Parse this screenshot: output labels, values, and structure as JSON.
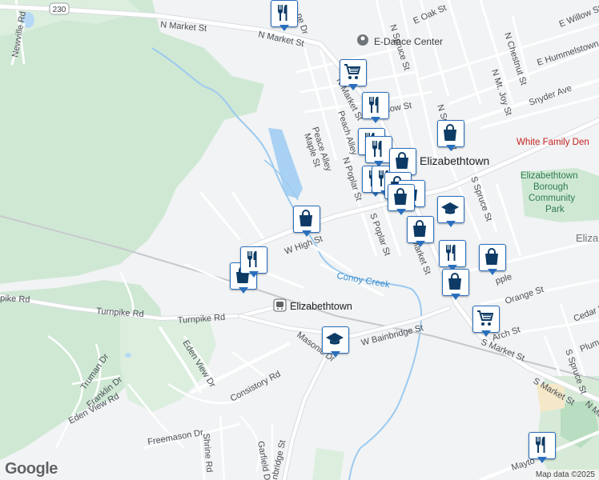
{
  "map": {
    "streets": {
      "n_market_1": "N Market St",
      "n_market_2": "N Market St",
      "n_market_3": "N Market St",
      "n_market_4": "N Market St",
      "route": "230",
      "newville": "Newville Rd",
      "w_high": "W High St",
      "turnpike_1": "Turnpike Rd",
      "turnpike_2": "Turnpike Rd",
      "pike": "pike Rd",
      "w_bainbridge": "W Bainbridge St",
      "s_market_1": "S Market St",
      "s_market_2": "S Market St",
      "masonic": "Masonic Dr",
      "consistory": "Consistory Rd",
      "eden_view_dr": "Eden View Dr",
      "eden_view_rd": "Eden View Rd",
      "truman": "Truman Dr",
      "franklin": "Franklin Dr",
      "freemason": "Freemason Dr",
      "shrine": "Shrine Rd",
      "garfield": "Garfield Dr",
      "bainbridge_n": "nbridge St",
      "peach_alley": "Peach Alley",
      "peace_alley": "Peace Alley",
      "maple": "Maple St",
      "n_poplar": "N Poplar St",
      "s_poplar": "S Poplar St",
      "n_spruce": "N Spruce St",
      "s_spruce_1": "S Spruce St",
      "s_spruce_2": "S Spruce St",
      "n_chestnut": "N Chestnut St",
      "n_mt_joy": "N Mt. Joy St",
      "snyder": "Snyder Ave",
      "e_hummelstown": "E Hummelstown St",
      "e_willow": "E Willow St",
      "e_oak": "E Oak St",
      "n_spruce_top": "N Spruce St",
      "orange": "Orange St",
      "arch": "Arch St",
      "cedar": "Cedar St",
      "plum": "Plum",
      "low": "low St",
      "ne_dr": "ne Dr",
      "n_ma": "N Ma",
      "mayto": "Mayto",
      "apple": "pple"
    },
    "places": {
      "town": "Elizabethtown",
      "station": "Elizabethtown",
      "dance": "E-Dance Center",
      "white_family": "White Family Den",
      "park": "Elizabethtown Borough Community Park",
      "park_l1": "Elizabethtown",
      "park_l2": "Borough",
      "park_l3": "Community",
      "park_l4": "Park",
      "eliza_edge": "Eliza",
      "creek": "Conoy Creek"
    },
    "attribution": "Map data ©2025",
    "logo": "Google"
  },
  "markers": [
    {
      "icon": "restaurant"
    },
    {
      "icon": "grocery"
    },
    {
      "icon": "restaurant"
    },
    {
      "icon": "restaurant"
    },
    {
      "icon": "restaurant"
    },
    {
      "icon": "restaurant"
    },
    {
      "icon": "shopping"
    },
    {
      "icon": "restaurant"
    },
    {
      "icon": "shopping"
    },
    {
      "icon": "shopping"
    },
    {
      "icon": "shopping"
    },
    {
      "icon": "shopping"
    },
    {
      "icon": "school"
    },
    {
      "icon": "shopping"
    },
    {
      "icon": "restaurant"
    },
    {
      "icon": "shopping"
    },
    {
      "icon": "shopping"
    },
    {
      "icon": "shopping"
    },
    {
      "icon": "restaurant"
    },
    {
      "icon": "shopping"
    },
    {
      "icon": "grocery"
    },
    {
      "icon": "school"
    },
    {
      "icon": "restaurant"
    }
  ]
}
